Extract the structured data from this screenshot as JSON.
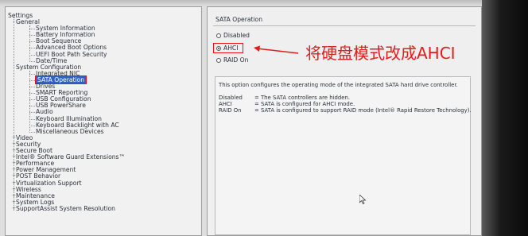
{
  "tree": {
    "root_label": "Settings",
    "items": [
      {
        "label": "General",
        "level": 1,
        "expander": "-"
      },
      {
        "label": "System Information",
        "level": 2
      },
      {
        "label": "Battery Information",
        "level": 2
      },
      {
        "label": "Boot Sequence",
        "level": 2
      },
      {
        "label": "Advanced Boot Options",
        "level": 2
      },
      {
        "label": "UEFI Boot Path Security",
        "level": 2
      },
      {
        "label": "Date/Time",
        "level": 2
      },
      {
        "label": "System Configuration",
        "level": 1,
        "expander": "-"
      },
      {
        "label": "Integrated NIC",
        "level": 2
      },
      {
        "label": "SATA Operation",
        "level": 2,
        "selected": true
      },
      {
        "label": "Drives",
        "level": 2
      },
      {
        "label": "SMART Reporting",
        "level": 2
      },
      {
        "label": "USB Configuration",
        "level": 2
      },
      {
        "label": "USB PowerShare",
        "level": 2
      },
      {
        "label": "Audio",
        "level": 2
      },
      {
        "label": "Keyboard Illumination",
        "level": 2
      },
      {
        "label": "Keyboard Backlight with AC",
        "level": 2
      },
      {
        "label": "Miscellaneous Devices",
        "level": 2
      },
      {
        "label": "Video",
        "level": 1,
        "expander": "+"
      },
      {
        "label": "Security",
        "level": 1,
        "expander": "+"
      },
      {
        "label": "Secure Boot",
        "level": 1,
        "expander": "+"
      },
      {
        "label": "Intel® Software Guard Extensions™",
        "level": 1,
        "expander": "+"
      },
      {
        "label": "Performance",
        "level": 1,
        "expander": "+"
      },
      {
        "label": "Power Management",
        "level": 1,
        "expander": "+"
      },
      {
        "label": "POST Behavior",
        "level": 1,
        "expander": "+"
      },
      {
        "label": "Virtualization Support",
        "level": 1,
        "expander": "+"
      },
      {
        "label": "Wireless",
        "level": 1,
        "expander": "+"
      },
      {
        "label": "Maintenance",
        "level": 1,
        "expander": "+"
      },
      {
        "label": "System Logs",
        "level": 1,
        "expander": "+"
      },
      {
        "label": "SupportAssist System Resolution",
        "level": 1,
        "expander": "+"
      }
    ]
  },
  "panel": {
    "group_title": "SATA Operation",
    "options": [
      {
        "label": "Disabled",
        "selected": false
      },
      {
        "label": "AHCI",
        "selected": true
      },
      {
        "label": "RAID On",
        "selected": false
      }
    ],
    "annotation": "将硬盘模式改成AHCI",
    "help": {
      "intro": "This option configures the operating mode of the integrated SATA hard drive controller.",
      "definitions": [
        {
          "term": "Disabled",
          "desc": "= The SATA controllers are hidden."
        },
        {
          "term": "AHCI",
          "desc": "= SATA is configured for AHCI mode."
        },
        {
          "term": "RAID On",
          "desc": "= SATA is configured to support RAID mode (Intel® Rapid Restore Technology)."
        }
      ]
    }
  },
  "colors": {
    "highlight": "#e41c1c",
    "selection": "#2f62c4"
  }
}
